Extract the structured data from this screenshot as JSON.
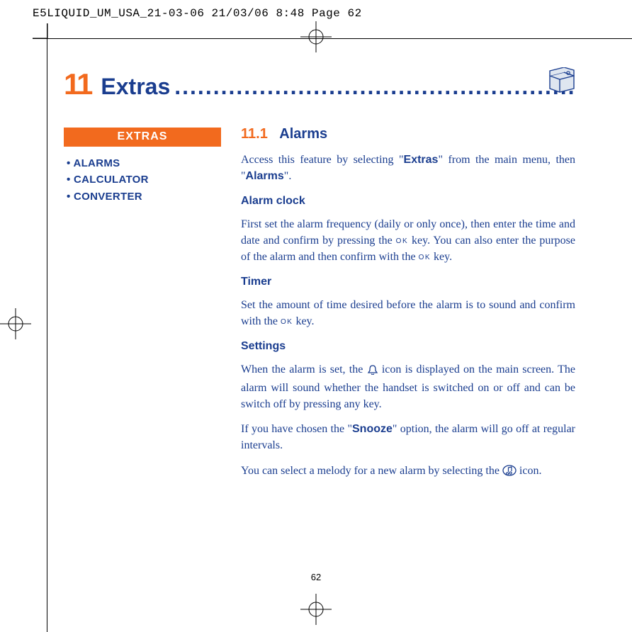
{
  "header": "E5LIQUID_UM_USA_21-03-06  21/03/06  8:48  Page 62",
  "chapter": {
    "num": "11",
    "title": "Extras"
  },
  "sidebar": {
    "title": "EXTRAS",
    "items": [
      "•  ALARMS",
      "•  CALCULATOR",
      "•  CONVERTER"
    ]
  },
  "section": {
    "num": "11.1",
    "title": "Alarms",
    "intro_a": "Access this feature by selecting \"",
    "intro_b": "Extras",
    "intro_c": "\" from the main menu, then \"",
    "intro_d": "Alarms",
    "intro_e": "\".",
    "h_clock": "Alarm clock",
    "clock_a": "First set the alarm frequency (daily or only once), then enter the time and date and confirm by pressing the ",
    "clock_b": " key. You can also enter the purpose of the alarm and then confirm with the ",
    "clock_c": " key.",
    "h_timer": "Timer",
    "timer_a": "Set the amount of time desired before the alarm is to sound and confirm with the ",
    "timer_b": " key.",
    "h_settings": "Settings",
    "set1_a": "When the alarm is set, the ",
    "set1_b": " icon is displayed on the main screen. The alarm will sound whether the handset is switched on or off and can be switch off by pressing any key.",
    "set2_a": "If you have chosen the \"",
    "set2_b": "Snooze",
    "set2_c": "\" option, the alarm will go off at regular intervals.",
    "set3_a": "You can select a melody for a new alarm by selecting the ",
    "set3_b": " icon."
  },
  "ok_label": "OK",
  "page_number": "62"
}
